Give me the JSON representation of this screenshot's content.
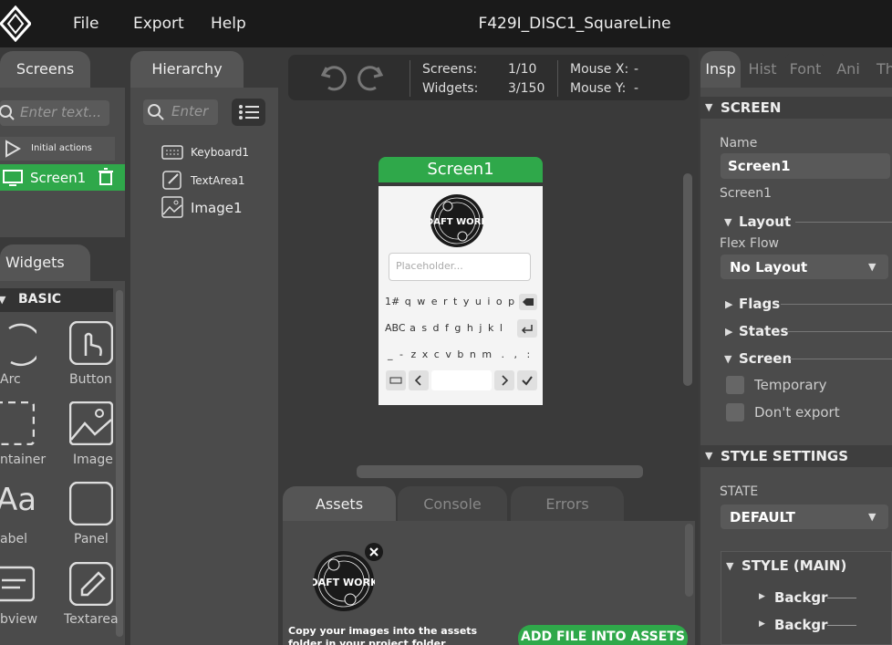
{
  "menu": {
    "file": "File",
    "export": "Export",
    "help": "Help"
  },
  "project_title": "F429I_DISC1_SquareLine",
  "screens": {
    "tab": "Screens",
    "search_placeholder": "Enter text...",
    "initial_actions": "Initial actions",
    "items": [
      {
        "label": "Screen1"
      }
    ]
  },
  "hierarchy": {
    "tab": "Hierarchy",
    "search_placeholder": "Enter",
    "items": [
      {
        "label": "Keyboard1"
      },
      {
        "label": "TextArea1"
      },
      {
        "label": "Image1"
      }
    ]
  },
  "widgets": {
    "tab": "Widgets",
    "category": "BASIC",
    "items": [
      {
        "label": "Arc"
      },
      {
        "label": "Button"
      },
      {
        "label": "ntainer"
      },
      {
        "label": "Image"
      },
      {
        "label": "abel"
      },
      {
        "label": "Panel"
      },
      {
        "label": "bview"
      },
      {
        "label": "Textarea"
      }
    ]
  },
  "toolbar": {
    "screens_label": "Screens:",
    "screens_value": "1/10",
    "widgets_label": "Widgets:",
    "widgets_value": "3/150",
    "mouse_x_label": "Mouse X:",
    "mouse_x_value": "-",
    "mouse_y_label": "Mouse Y:",
    "mouse_y_value": "-"
  },
  "device": {
    "screen_title": "Screen1",
    "logo_text": "DAFT WORK",
    "textarea_placeholder": "Placeholder...",
    "keys_row1": [
      "1#",
      "q",
      "w",
      "e",
      "r",
      "t",
      "y",
      "u",
      "i",
      "o",
      "p"
    ],
    "keys_row2": [
      "ABC",
      "a",
      "s",
      "d",
      "f",
      "g",
      "h",
      "j",
      "k",
      "l"
    ],
    "keys_row3": [
      "_",
      "-",
      "z",
      "x",
      "c",
      "v",
      "b",
      "n",
      "m",
      ".",
      ",",
      ":"
    ]
  },
  "bottom": {
    "tabs": {
      "assets": "Assets",
      "console": "Console",
      "errors": "Errors"
    },
    "asset_logo_text": "DAFT WORK",
    "hint": "Copy your images into the assets folder in your project folder",
    "add_button": "ADD FILE INTO ASSETS"
  },
  "inspector": {
    "tabs": [
      "Insp",
      "Hist",
      "Font",
      "Ani",
      "Th"
    ],
    "screen_section": "SCREEN",
    "name_label": "Name",
    "name_value": "Screen1",
    "screen_type": "Screen1",
    "layout": "Layout",
    "flex_flow_label": "Flex Flow",
    "flex_flow_value": "No Layout",
    "flags": "Flags",
    "states": "States",
    "screen_sub": "Screen",
    "temporary": "Temporary",
    "dont_export": "Don't export",
    "style_settings": "STYLE SETTINGS",
    "state_label": "STATE",
    "state_value": "DEFAULT",
    "style_main": "STYLE (MAIN)",
    "backgr1": "Backgr",
    "backgr2": "Backgr"
  },
  "colors": {
    "accent_green": "#2fa84a",
    "topbar": "#1a1a1a",
    "panel": "#4b4b4b"
  }
}
